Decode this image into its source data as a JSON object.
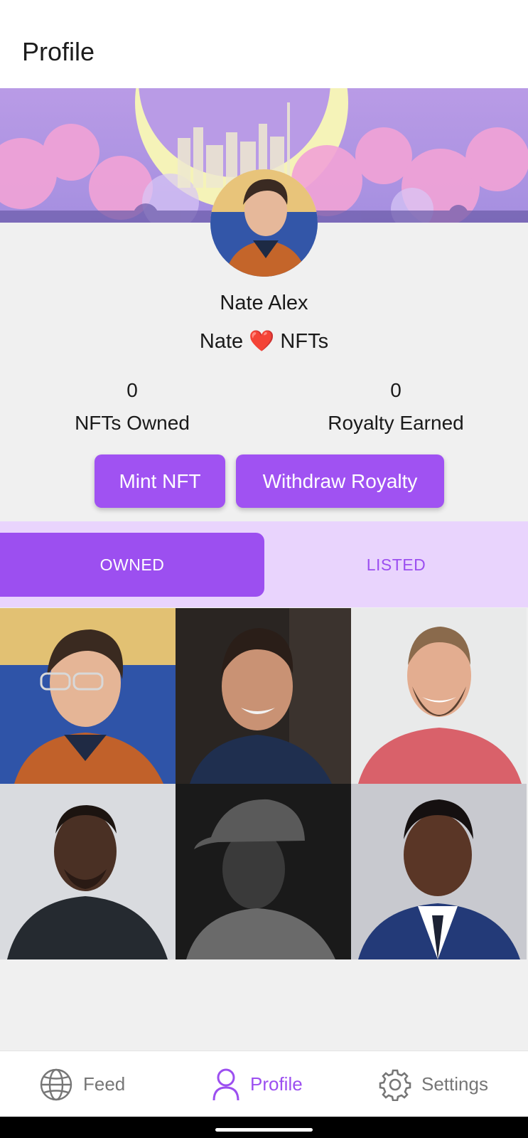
{
  "app_bar": {
    "title": "Profile"
  },
  "profile": {
    "name": "Nate Alex",
    "bio_prefix": "Nate",
    "bio_heart": "❤️",
    "bio_suffix": "NFTs"
  },
  "stats": {
    "owned_value": "0",
    "owned_label": "NFTs Owned",
    "royalty_value": "0",
    "royalty_label": "Royalty Earned"
  },
  "actions": {
    "mint_label": "Mint NFT",
    "withdraw_label": "Withdraw Royalty"
  },
  "tabs": [
    {
      "label": "OWNED",
      "active": true
    },
    {
      "label": "LISTED",
      "active": false
    }
  ],
  "nav": [
    {
      "label": "Feed",
      "icon": "globe-icon",
      "active": false
    },
    {
      "label": "Profile",
      "icon": "person-icon",
      "active": true
    },
    {
      "label": "Settings",
      "icon": "gear-icon",
      "active": false
    }
  ],
  "colors": {
    "accent": "#a052f2",
    "tab_bar": "#e9d4fd",
    "background": "#f0f0f0"
  }
}
